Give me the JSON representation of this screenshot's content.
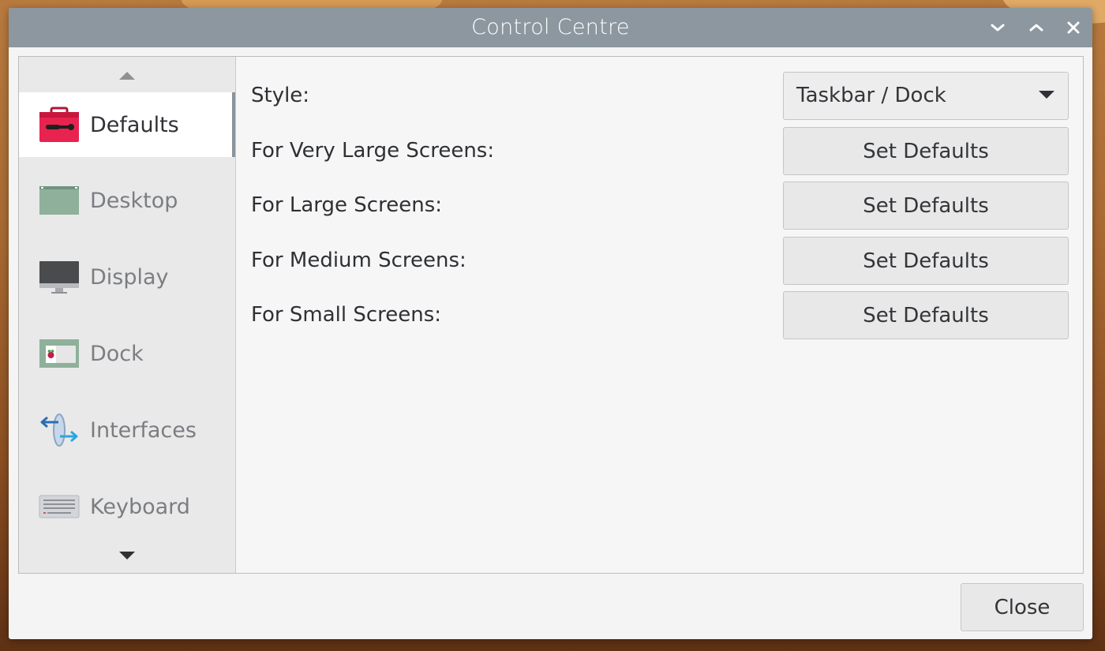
{
  "window": {
    "title": "Control Centre"
  },
  "sidebar": {
    "items": [
      {
        "label": "Defaults",
        "icon": "toolbox-icon",
        "active": true
      },
      {
        "label": "Desktop",
        "icon": "desktop-icon"
      },
      {
        "label": "Display",
        "icon": "monitor-icon"
      },
      {
        "label": "Dock",
        "icon": "dock-icon"
      },
      {
        "label": "Interfaces",
        "icon": "interfaces-icon"
      },
      {
        "label": "Keyboard",
        "icon": "keyboard-icon"
      }
    ]
  },
  "main": {
    "style": {
      "label": "Style:",
      "value": "Taskbar / Dock"
    },
    "rows": [
      {
        "label": "For Very Large Screens:",
        "button": "Set Defaults"
      },
      {
        "label": "For Large Screens:",
        "button": "Set Defaults"
      },
      {
        "label": "For Medium Screens:",
        "button": "Set Defaults"
      },
      {
        "label": "For Small Screens:",
        "button": "Set Defaults"
      }
    ]
  },
  "footer": {
    "close_label": "Close"
  },
  "colors": {
    "titlebar": "#8c979f",
    "accent_red": "#e8234f",
    "selection_bar": "#8b949b"
  }
}
